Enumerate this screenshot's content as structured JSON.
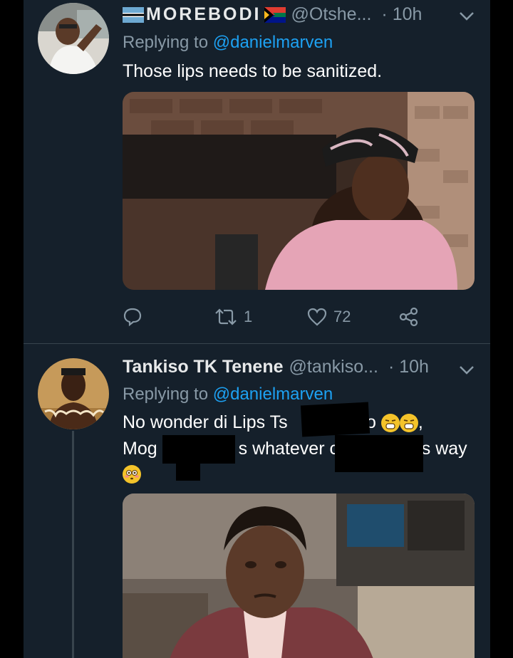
{
  "tweets": [
    {
      "display_name": "MOREBODI",
      "handle": "@Otshe...",
      "time": "· 10h",
      "replying_prefix": "Replying to ",
      "replying_to": "@danielmarven",
      "text": "Those lips needs to be sanitized.",
      "actions": {
        "retweets": "1",
        "likes": "72"
      }
    },
    {
      "display_name": "Tankiso TK Tenene",
      "handle": "@tankiso...",
      "time": "· 10h",
      "replying_prefix": "Replying to ",
      "replying_to": "@danielmarven",
      "text_line1_a": "No wonder di Lips Ts",
      "text_line1_b": "soo",
      "text_line1_c": ",",
      "text_line2_a": "Mog",
      "text_line2_b": "s whatever c",
      "text_line2_c": "'s way"
    }
  ],
  "colors": {
    "background": "#15202b",
    "mention": "#1da1f2",
    "secondary_text": "#8899a6",
    "divider": "#38444d"
  },
  "icons": {
    "botswana_flag": "botswana-flag-icon",
    "south_africa_flag": "south-africa-flag-icon",
    "chevron": "chevron-down-icon",
    "reply": "reply-icon",
    "retweet": "retweet-icon",
    "like": "heart-icon",
    "share": "share-icon",
    "anguished_emoji": "anguished-face-emoji",
    "flushed_emoji": "flushed-face-emoji"
  }
}
